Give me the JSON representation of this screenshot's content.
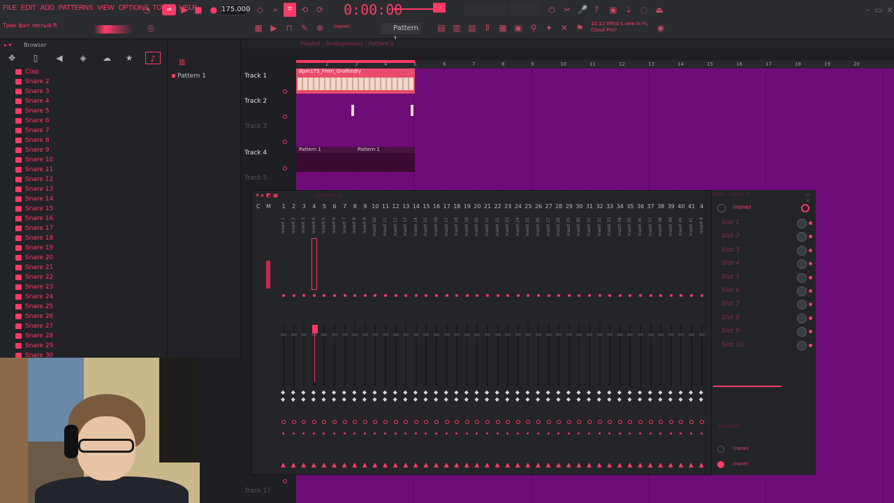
{
  "menu": [
    "FILE",
    "EDIT",
    "ADD",
    "PATTERNS",
    "VIEW",
    "OPTIONS",
    "TOOLS",
    "HELP"
  ],
  "transport": {
    "tempo": "175.000",
    "time": "0:00:00",
    "pattern": "Pattern 1"
  },
  "hint": "Трек фит лютый ft",
  "news": {
    "line1": "10.12 What's new in FL",
    "line2": "Cloud Pro?"
  },
  "browser": {
    "title": "Browser",
    "items": [
      "Clap",
      "Snare 2",
      "Snare 3",
      "Snare 4",
      "Snare 5",
      "Snare 6",
      "Snare 7",
      "Snare 8",
      "Snare 9",
      "Snare 10",
      "Snare 11",
      "Snare 12",
      "Snare 13",
      "Snare 14",
      "Snare 15",
      "Snare 16",
      "Snare 17",
      "Snare 18",
      "Snare 19",
      "Snare 20",
      "Snare 21",
      "Snare 22",
      "Snare 23",
      "Snare 24",
      "Snare 25",
      "Snare 26",
      "Snare 27",
      "Snare 28",
      "Snare 29",
      "Snare 30"
    ]
  },
  "patterns": {
    "items": [
      "Pattern 1"
    ]
  },
  "playlist": {
    "title": "Playlist - Arrangement › Pattern 1",
    "tracks": [
      "Track 1",
      "Track 2",
      "Track 3",
      "Track 4",
      "Track 5",
      "Track 17"
    ],
    "ruler": [
      "2",
      "3",
      "4",
      "5",
      "6",
      "7",
      "8",
      "9",
      "10",
      "11",
      "12",
      "13",
      "14",
      "15",
      "16",
      "17",
      "18",
      "19",
      "20"
    ],
    "clip_audio": "Bpm175_Fmin_Grafitedry",
    "clip_pattern_a": "Pattern 1",
    "clip_pattern_b": "Pattern 1"
  },
  "mixer": {
    "title": "Compact 2",
    "master_label": "C",
    "m_label": "M",
    "channels": [
      "1",
      "2",
      "3",
      "4",
      "5",
      "6",
      "7",
      "8",
      "9",
      "10",
      "11",
      "12",
      "13",
      "14",
      "15",
      "16",
      "17",
      "18",
      "19",
      "20",
      "21",
      "22",
      "23",
      "24",
      "25",
      "26",
      "27",
      "28",
      "29",
      "30",
      "31",
      "32",
      "33",
      "34",
      "35",
      "36",
      "37",
      "38",
      "39",
      "40",
      "41",
      "4"
    ]
  },
  "insert": {
    "title": "Mixer - Insert 4",
    "preset": "(none)",
    "slots": [
      "Slot 1",
      "Slot 2",
      "Slot 3",
      "Slot 4",
      "Slot 5",
      "Slot 6",
      "Slot 7",
      "Slot 8",
      "Slot 9",
      "Slot 10"
    ],
    "eq_label": "Equalizer",
    "route_a": "(none)",
    "route_b": "(none)"
  },
  "colors": {
    "accent": "#ff3a66",
    "playlist_bg": "#6e0d78",
    "panel": "#242529"
  },
  "icons": [
    "play-icon",
    "stop-icon",
    "record-icon",
    "folder-icon",
    "speaker-icon",
    "star-icon",
    "magnet-icon",
    "pencil-icon",
    "piano-icon"
  ]
}
